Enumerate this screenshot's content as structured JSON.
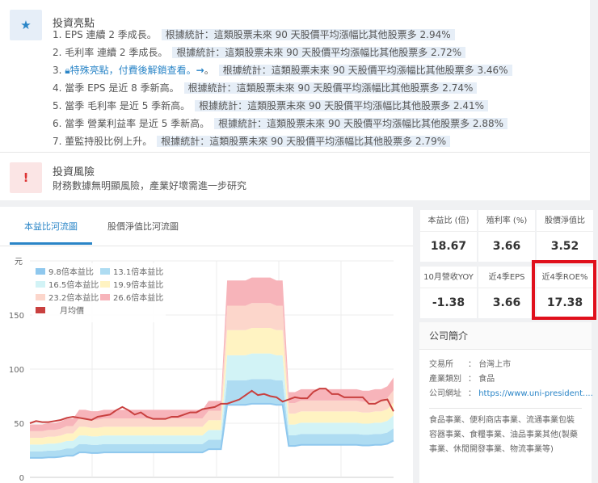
{
  "highlights": {
    "title": "投資亮點",
    "icon": "star-icon",
    "items": [
      {
        "text": "1. EPS 連續 2 季成長。",
        "stat": "根據統計：這類股票未來 90 天股價平均漲幅比其他股票多 2.94%"
      },
      {
        "text": "2. 毛利率 連續 2 季成長。",
        "stat": "根據統計：這類股票未來 90 天股價平均漲幅比其他股票多 2.72%"
      },
      {
        "text": "3. ",
        "locked": "特殊亮點，付費後解鎖查看。",
        "arrow": "→",
        "after": "。",
        "stat": "根據統計：這類股票未來 90 天股價平均漲幅比其他股票多 3.46%"
      },
      {
        "text": "4. 當季 EPS 是近 8 季新高。",
        "stat": "根據統計：這類股票未來 90 天股價平均漲幅比其他股票多 2.74%"
      },
      {
        "text": "5. 當季 毛利率 是近 5 季新高。",
        "stat": "根據統計：這類股票未來 90 天股價平均漲幅比其他股票多 2.41%"
      },
      {
        "text": "6. 當季 營業利益率 是近 5 季新高。",
        "stat": "根據統計：這類股票未來 90 天股價平均漲幅比其他股票多 2.88%"
      },
      {
        "text": "7. 董監持股比例上升。",
        "stat": "根據統計：這類股票未來 90 天股價平均漲幅比其他股票多 2.79%"
      }
    ]
  },
  "risk": {
    "title": "投資風險",
    "icon": "!",
    "text": "財務數據無明顯風險，產業好壞需進一步研究"
  },
  "tabs": [
    "本益比河流圖",
    "股價淨值比河流圖"
  ],
  "metrics": [
    {
      "label": "本益比 (倍)",
      "value": "18.67"
    },
    {
      "label": "殖利率 (%)",
      "value": "3.66"
    },
    {
      "label": "股價淨值比",
      "value": "3.52"
    },
    {
      "label": "10月營收YOY",
      "value": "-1.38"
    },
    {
      "label": "近4季EPS",
      "value": "3.66"
    },
    {
      "label": "近4季ROE%",
      "value": "17.38"
    }
  ],
  "company": {
    "title": "公司簡介",
    "rows": [
      {
        "key": "交易所",
        "sep": "：",
        "value": "台灣上市"
      },
      {
        "key": "產業類別",
        "sep": "：",
        "value": "食品"
      },
      {
        "key": "公司網址",
        "sep": "：",
        "value": "https://www.uni-president...."
      }
    ],
    "description": "食品事業、便利商店事業、流通事業包裝容器事業、食糧事業、油品事業其他(製藥事業、休閒開發事業、物流事業等)"
  },
  "chart_data": {
    "type": "area",
    "ylabel": "元",
    "ylim": [
      0,
      200
    ],
    "yticks": [
      0,
      50,
      100,
      150
    ],
    "grid": true,
    "legend_position": "top-left",
    "bands": [
      {
        "name": "9.8倍本益比",
        "multiple": 9.8,
        "color": "#8fc8ee"
      },
      {
        "name": "13.1倍本益比",
        "multiple": 13.1,
        "color": "#aedcf2"
      },
      {
        "name": "16.5倍本益比",
        "multiple": 16.5,
        "color": "#d2f3f6"
      },
      {
        "name": "19.9倍本益比",
        "multiple": 19.9,
        "color": "#fff3c2"
      },
      {
        "name": "23.2倍本益比",
        "multiple": 23.2,
        "color": "#fcd6cb"
      },
      {
        "name": "26.6倍本益比",
        "multiple": 26.6,
        "color": "#f7b4ba"
      }
    ],
    "price_series": {
      "name": "月均價",
      "color": "#c9403f"
    },
    "band_9_8x": [
      18,
      18,
      18,
      18.5,
      18.5,
      19,
      20,
      20,
      23,
      23,
      22.5,
      22.5,
      23,
      23,
      23,
      23,
      23,
      23,
      23,
      23,
      23,
      23,
      23,
      23,
      23,
      23,
      23,
      23,
      23,
      26,
      26,
      26,
      67,
      67,
      67,
      67,
      68,
      68,
      68,
      68,
      67,
      67,
      29,
      29,
      30,
      30,
      30,
      30,
      30,
      30,
      30,
      30,
      30,
      30,
      29.5,
      29.5,
      30,
      30,
      31,
      34
    ],
    "price": [
      50,
      52,
      51,
      51,
      52,
      53,
      55,
      56,
      55,
      54,
      53,
      56,
      57,
      58,
      62,
      65,
      62,
      58,
      60,
      56,
      54,
      54,
      54,
      56,
      56,
      58,
      60,
      60,
      63,
      64,
      65,
      68,
      68,
      70,
      72,
      76,
      80,
      76,
      77,
      75,
      74,
      70,
      72,
      74,
      73,
      73,
      79,
      82,
      82,
      77,
      77,
      74,
      74,
      74,
      74,
      68,
      68,
      71,
      72,
      61
    ]
  }
}
